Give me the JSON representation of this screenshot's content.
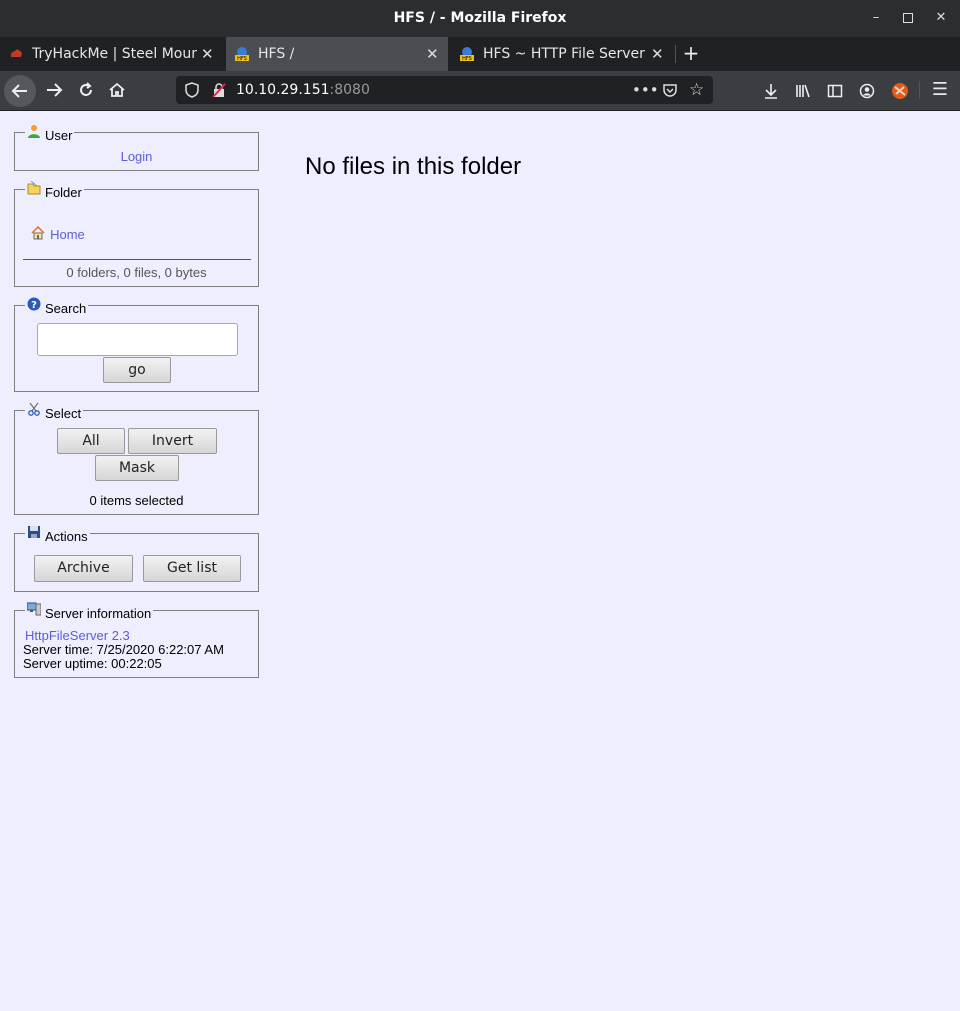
{
  "window": {
    "title": "HFS / - Mozilla Firefox"
  },
  "tabs": [
    {
      "label": "TryHackMe | Steel Mount",
      "active": false
    },
    {
      "label": "HFS /",
      "active": true
    },
    {
      "label": "HFS ~ HTTP File Server",
      "active": false
    }
  ],
  "address": {
    "host": "10.10.29.151",
    "port": ":8080"
  },
  "sidebar": {
    "user": {
      "legend": "User",
      "login": "Login"
    },
    "folder": {
      "legend": "Folder",
      "home": "Home",
      "stats": "0 folders, 0 files, 0 bytes"
    },
    "search": {
      "legend": "Search",
      "value": "",
      "go": "go"
    },
    "select": {
      "legend": "Select",
      "all": "All",
      "invert": "Invert",
      "mask": "Mask",
      "status": "0 items selected"
    },
    "actions": {
      "legend": "Actions",
      "archive": "Archive",
      "get_list": "Get list"
    },
    "server": {
      "legend": "Server information",
      "version": "HttpFileServer 2.3",
      "time": "Server time: 7/25/2020 6:22:07 AM",
      "uptime": "Server uptime: 00:22:05"
    }
  },
  "main": {
    "message": "No files in this folder"
  }
}
